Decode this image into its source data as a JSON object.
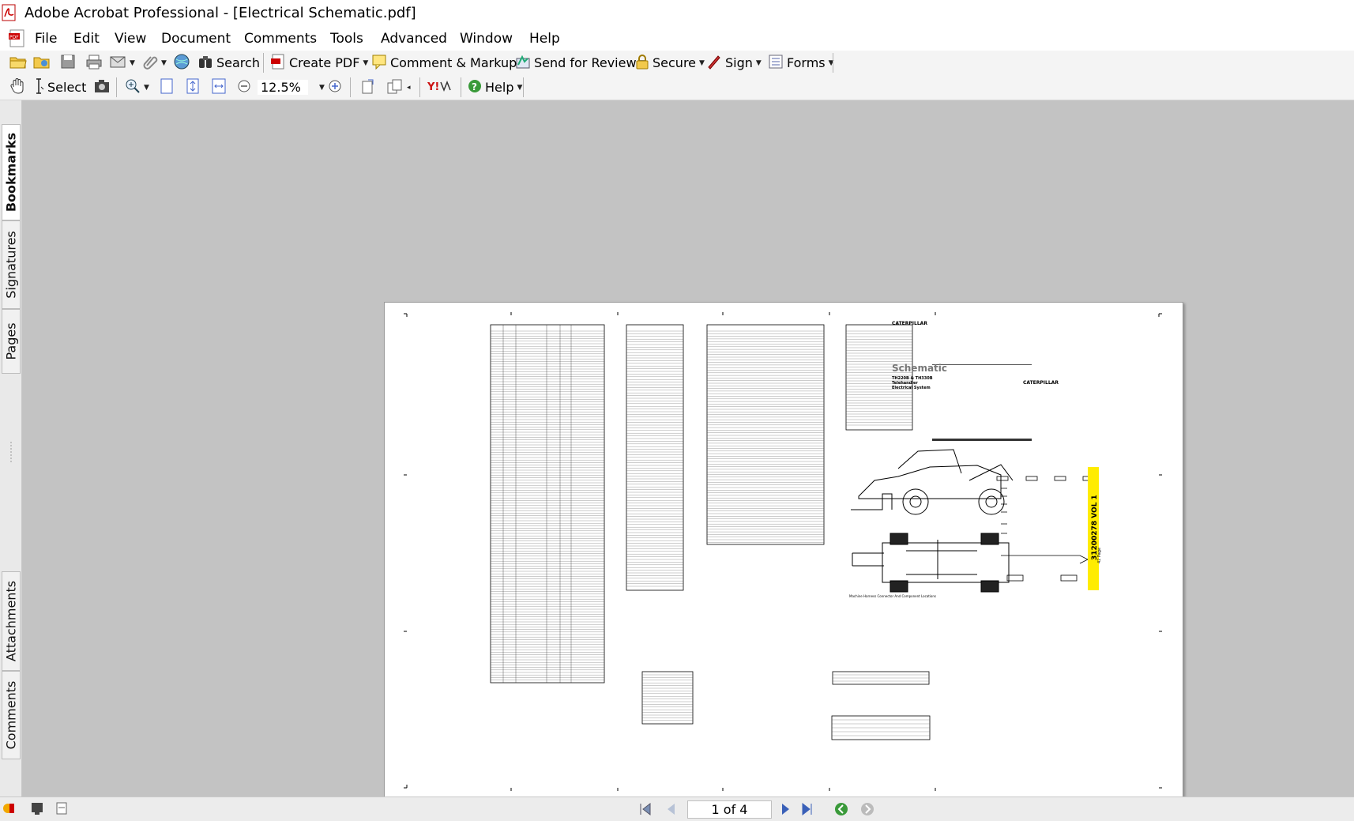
{
  "window": {
    "title": "Adobe Acrobat Professional - [Electrical Schematic.pdf]"
  },
  "menu": [
    "File",
    "Edit",
    "View",
    "Document",
    "Comments",
    "Tools",
    "Advanced",
    "Window",
    "Help"
  ],
  "toolbar1": {
    "search": "Search",
    "create_pdf": "Create PDF",
    "comment_markup": "Comment & Markup",
    "send_review": "Send for Review",
    "secure": "Secure",
    "sign": "Sign",
    "forms": "Forms"
  },
  "toolbar2": {
    "select": "Select",
    "zoom": "12.5%",
    "help": "Help"
  },
  "nav_tabs": [
    "Bookmarks",
    "Signatures",
    "Pages",
    "Attachments",
    "Comments"
  ],
  "document": {
    "brand": "CATERPILLAR",
    "schematic_title": "Schematic",
    "models": "TH220B & TH330B",
    "subtitle1": "Telehandler",
    "subtitle2": "Electrical System",
    "spine_text": "31200278 VOL 1",
    "spine_sub": "42 Page",
    "caption": "Machine Harness Connector And Component Locations"
  },
  "status": {
    "page_indicator": "1 of 4"
  },
  "colors": {
    "spine": "#ffec00",
    "accent_red": "#cc1111"
  }
}
